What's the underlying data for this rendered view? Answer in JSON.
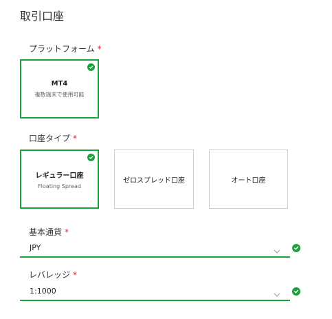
{
  "page": {
    "title": "取引口座"
  },
  "platform": {
    "label": "プラットフォーム",
    "required": "*",
    "options": [
      {
        "name": "MT4",
        "sub": "複数端末で使用可能",
        "selected": true
      }
    ]
  },
  "account_type": {
    "label": "口座タイプ",
    "required": "*",
    "options": [
      {
        "name": "レギュラー口座",
        "sub": "Floating Spread",
        "selected": true
      },
      {
        "name": "ゼロスプレッド口座",
        "selected": false
      },
      {
        "name": "オート口座",
        "selected": false
      }
    ]
  },
  "currency": {
    "label": "基本通貨",
    "required": "*",
    "value": "JPY"
  },
  "leverage": {
    "label": "レバレッジ",
    "required": "*",
    "value": "1:1000"
  },
  "colors": {
    "accent": "#1aa33a",
    "required": "#e0262f",
    "border": "#cfcfcf"
  }
}
